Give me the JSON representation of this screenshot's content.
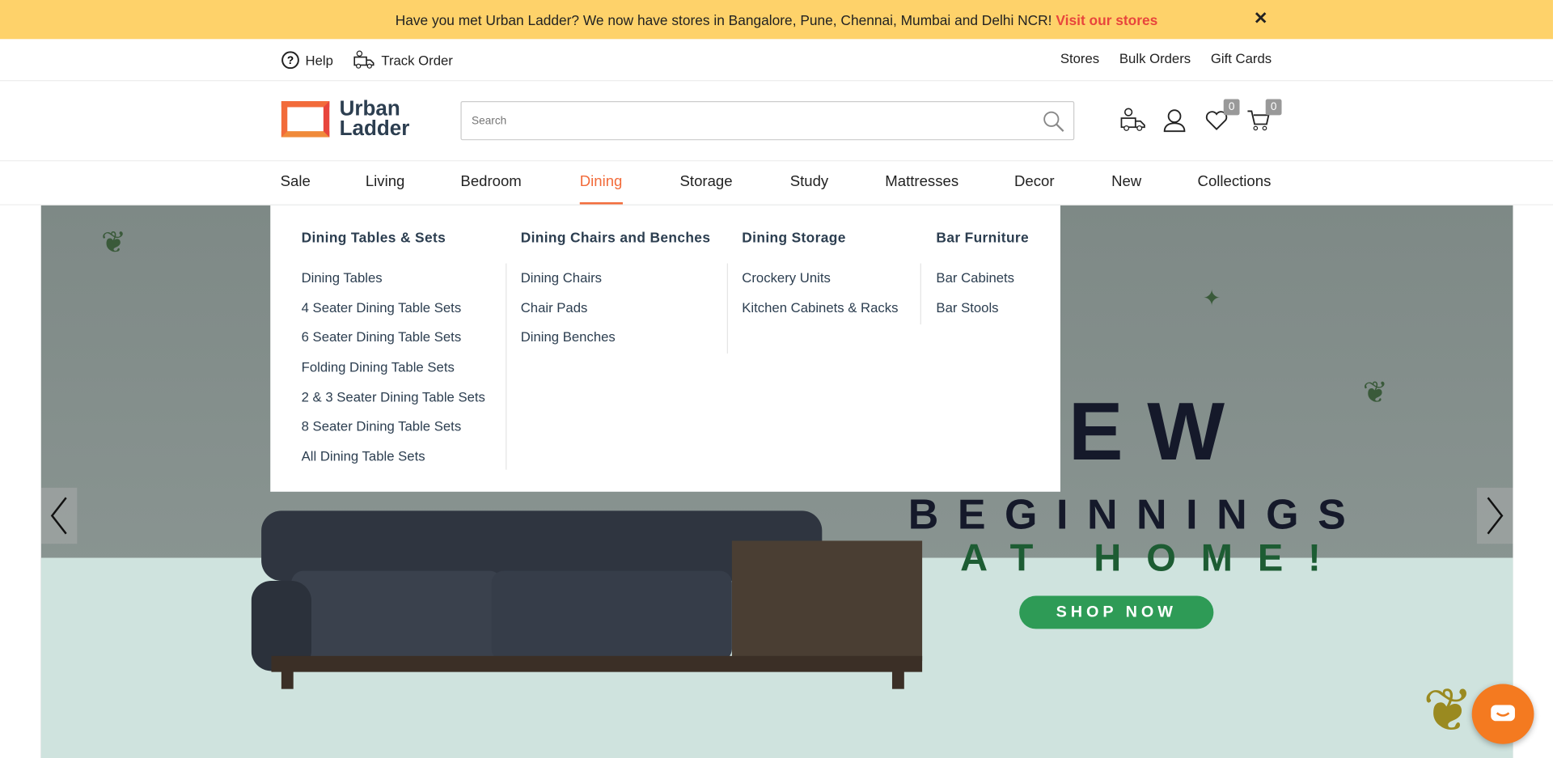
{
  "banner": {
    "text": "Have you met Urban Ladder? We now have stores in Bangalore, Pune, Chennai, Mumbai and Delhi NCR!",
    "link": "Visit our stores",
    "close": "✕"
  },
  "util": {
    "help": "Help",
    "track": "Track Order",
    "stores": "Stores",
    "bulk": "Bulk Orders",
    "gift": "Gift Cards"
  },
  "logo": {
    "line1": "Urban",
    "line2": "Ladder"
  },
  "search": {
    "placeholder": "Search"
  },
  "counts": {
    "wishlist": "0",
    "cart": "0"
  },
  "nav": [
    "Sale",
    "Living",
    "Bedroom",
    "Dining",
    "Storage",
    "Study",
    "Mattresses",
    "Decor",
    "New",
    "Collections"
  ],
  "menu": [
    {
      "title": "Dining Tables & Sets",
      "links": [
        "Dining Tables",
        "4 Seater Dining Table Sets",
        "6 Seater Dining Table Sets",
        "Folding Dining Table Sets",
        "2 & 3 Seater Dining Table Sets",
        "8 Seater Dining Table Sets",
        "All Dining Table Sets"
      ]
    },
    {
      "title": "Dining Chairs and Benches",
      "links": [
        "Dining Chairs",
        "Chair Pads",
        "Dining Benches"
      ]
    },
    {
      "title": "Dining Storage",
      "links": [
        "Crockery Units",
        "Kitchen Cabinets & Racks"
      ]
    },
    {
      "title": "Bar Furniture",
      "links": [
        "Bar Cabinets",
        "Bar Stools"
      ]
    }
  ],
  "hero": {
    "line1": "EW",
    "line2": "BEGINNINGS",
    "line3": "AT HOME!",
    "cta": "SHOP NOW"
  },
  "colors": {
    "accent": "#f26b3a",
    "banner": "#fed26a",
    "cta": "#2e9b56"
  }
}
